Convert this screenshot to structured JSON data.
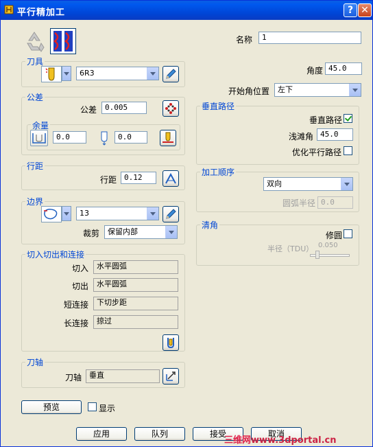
{
  "window": {
    "title": "平行精加工"
  },
  "name": {
    "label": "名称",
    "value": "1"
  },
  "tool": {
    "group_title": "刀具",
    "value": "6R3"
  },
  "angle": {
    "label": "角度",
    "value": "45.0"
  },
  "start_corner": {
    "label": "开始角位置",
    "value": "左下"
  },
  "tolerance": {
    "group_title": "公差",
    "label": "公差",
    "value": "0.005"
  },
  "allowance": {
    "group_title": "余量",
    "radial": "0.0",
    "axial": "0.0"
  },
  "vertical_path": {
    "group_title": "垂直路径",
    "vertical_label": "垂直路径",
    "vertical_checked": true,
    "shallow_label": "浅滩角",
    "shallow_value": "45.0",
    "optimize_label": "优化平行路径",
    "optimize_checked": false
  },
  "stepover": {
    "group_title": "行距",
    "label": "行距",
    "value": "0.12"
  },
  "order": {
    "group_title": "加工顺序",
    "value": "双向",
    "arc_label": "圆弧半径",
    "arc_value": "0.0"
  },
  "boundary": {
    "group_title": "边界",
    "value": "13",
    "trim_label": "裁剪",
    "trim_value": "保留内部"
  },
  "corner": {
    "group_title": "清角",
    "fillet_label": "修圆",
    "fillet_checked": false,
    "radius_label": "半径（TDU）",
    "radius_value": "0.050"
  },
  "leads": {
    "group_title": "切入切出和连接",
    "lead_in_label": "切入",
    "lead_in_value": "水平圆弧",
    "lead_out_label": "切出",
    "lead_out_value": "水平圆弧",
    "short_link_label": "短连接",
    "short_link_value": "下切步距",
    "long_link_label": "长连接",
    "long_link_value": "掠过"
  },
  "tool_axis": {
    "group_title": "刀轴",
    "label": "刀轴",
    "value": "垂直"
  },
  "preview": {
    "button": "预览",
    "show_label": "显示"
  },
  "footer": {
    "apply": "应用",
    "queue": "队列",
    "accept": "接受",
    "cancel": "取消"
  },
  "watermark": {
    "part1": "三维网",
    "part2": "www.3dportal.cn"
  }
}
